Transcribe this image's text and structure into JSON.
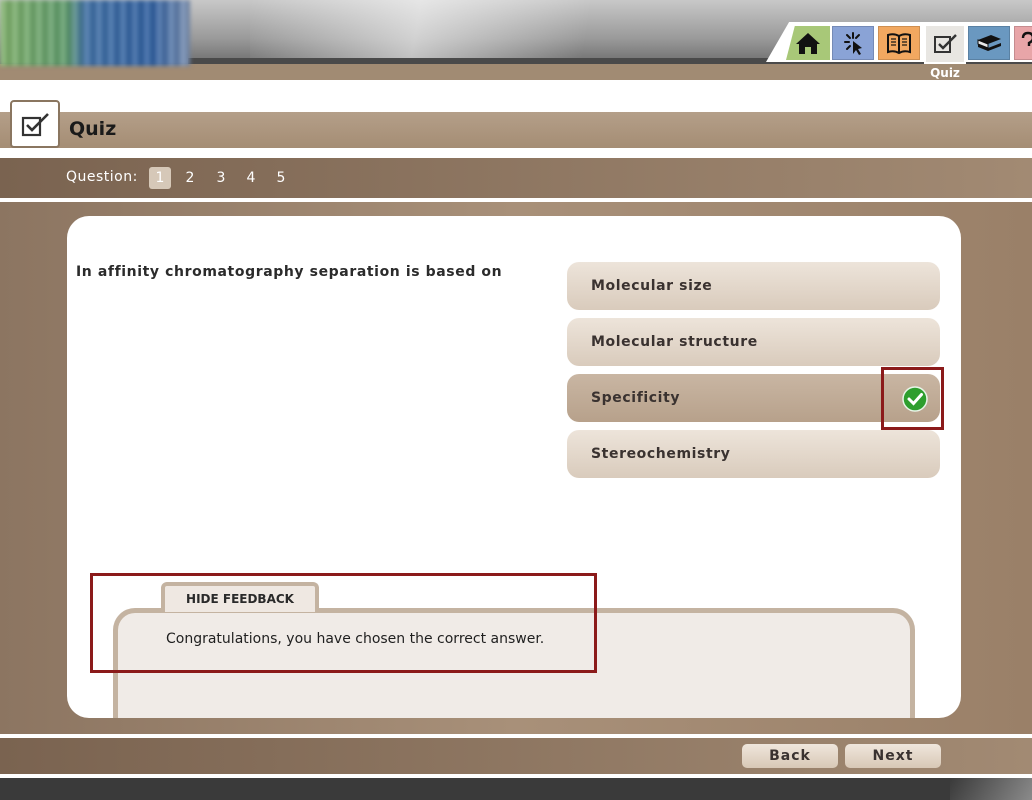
{
  "nav": {
    "items": [
      {
        "icon": "home-icon"
      },
      {
        "icon": "activity-icon"
      },
      {
        "icon": "book-icon"
      },
      {
        "icon": "quiz-icon",
        "label": "Quiz"
      },
      {
        "icon": "library-icon"
      },
      {
        "icon": "help-icon"
      }
    ],
    "active_label": "Quiz"
  },
  "header": {
    "title": "Quiz",
    "icon": "checkbox-icon"
  },
  "question_nav": {
    "label": "Question:",
    "numbers": [
      "1",
      "2",
      "3",
      "4",
      "5"
    ],
    "active": "1"
  },
  "question": {
    "text": "In affinity chromatography separation is based on",
    "options": [
      {
        "label": "Molecular size",
        "selected": false
      },
      {
        "label": "Molecular structure",
        "selected": false
      },
      {
        "label": "Specificity",
        "selected": true,
        "status": "correct"
      },
      {
        "label": "Stereochemistry",
        "selected": false
      }
    ]
  },
  "feedback": {
    "toggle_label": "HIDE FEEDBACK",
    "message": "Congratulations, you have chosen the correct answer."
  },
  "footer_nav": {
    "back_label": "Back",
    "next_label": "Next"
  },
  "colors": {
    "accent_brown": "#a18b73",
    "highlight": "#8b1a1a",
    "correct_green": "#2e9e2e"
  }
}
